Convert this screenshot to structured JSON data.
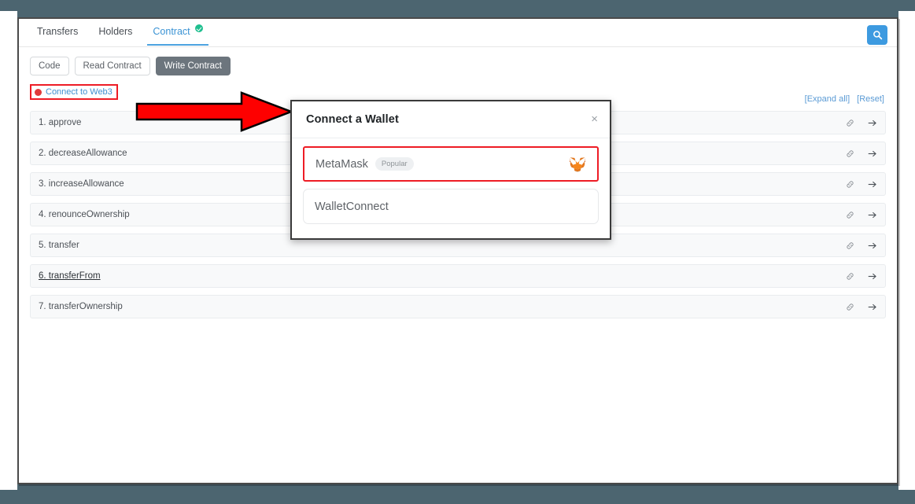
{
  "window": {
    "background_color": "#4c6570",
    "canvas_color": "#ffffff"
  },
  "tabs": [
    {
      "label": "Transfers",
      "active": false,
      "verified": false
    },
    {
      "label": "Holders",
      "active": false,
      "verified": false
    },
    {
      "label": "Contract",
      "active": true,
      "verified": true
    }
  ],
  "search": {
    "icon": "search-icon",
    "color": "#3d9ae0"
  },
  "subtabs": [
    {
      "label": "Code",
      "selected": false
    },
    {
      "label": "Read Contract",
      "selected": false
    },
    {
      "label": "Write Contract",
      "selected": true
    }
  ],
  "connect": {
    "label": "Connect to Web3",
    "status_color": "#e03b3b",
    "link_color": "#3e8fd0",
    "annotation_color": "#ee1c25"
  },
  "list_tools": {
    "expand_all": "[Expand all]",
    "reset": "[Reset]",
    "link_color": "#5b9bd5"
  },
  "functions": [
    {
      "label": "1. approve",
      "hovered": false
    },
    {
      "label": "2. decreaseAllowance",
      "hovered": false
    },
    {
      "label": "3. increaseAllowance",
      "hovered": false
    },
    {
      "label": "4. renounceOwnership",
      "hovered": false
    },
    {
      "label": "5. transfer",
      "hovered": false
    },
    {
      "label": "6. transferFrom",
      "hovered": true
    },
    {
      "label": "7. transferOwnership",
      "hovered": false
    }
  ],
  "row_icons": {
    "link": "chain-link-icon",
    "arrow": "arrow-right-icon"
  },
  "modal": {
    "title": "Connect a Wallet",
    "close_label": "×",
    "wallets": [
      {
        "name": "MetaMask",
        "tag": "Popular",
        "logo": "metamask-fox-icon",
        "highlighted": true
      },
      {
        "name": "WalletConnect",
        "tag": "",
        "logo": "",
        "highlighted": false
      }
    ]
  },
  "annotation": {
    "arrow_fill": "#fe0000",
    "arrow_stroke": "#000000"
  }
}
